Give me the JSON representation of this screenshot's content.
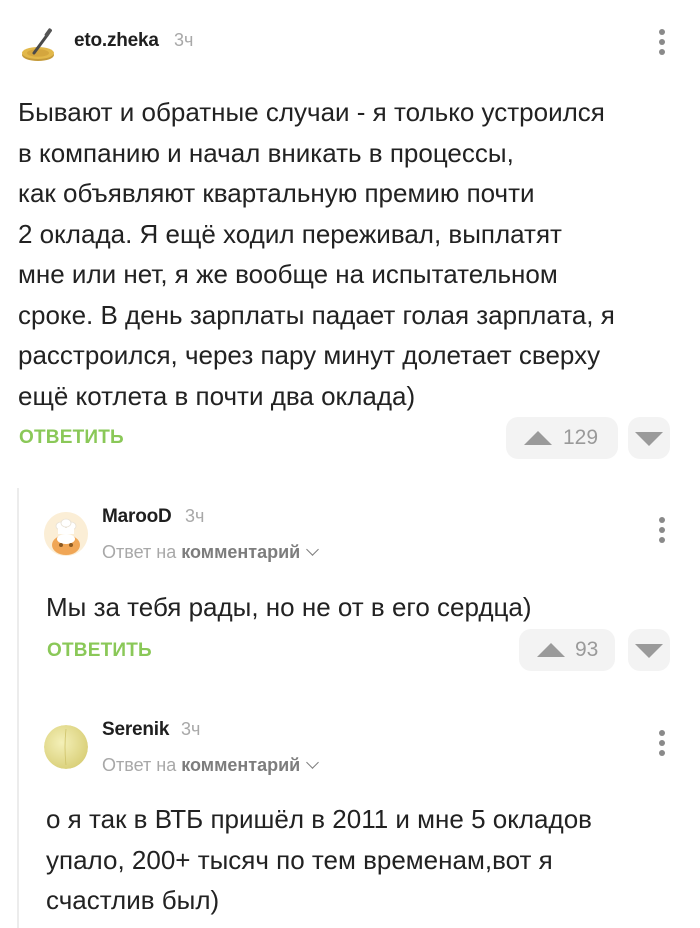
{
  "comments": [
    {
      "author": "eto.zheka",
      "time": "3ч",
      "text": "Бывают и обратные случаи - я только устроился\nв компанию и начал вникать в процессы,\nкак объявляют квартальную премию почти\n2 оклада. Я ещё ходил переживал, выплатят\nмне или нет, я же вообще на испытательном\nсроке. В день зарплаты падает голая зарплата, я\nрасстроился, через пару минут долетает сверху\nещё котлета в почти два оклада)",
      "reply_label": "ОТВЕТИТЬ",
      "rating": "129"
    },
    {
      "author": "MarooD",
      "time": "3ч",
      "reply_to_prefix": "Ответ на",
      "reply_to_target": "комментарий",
      "text": "Мы за тебя рады, но не от в его сердца)",
      "reply_label": "ОТВЕТИТЬ",
      "rating": "93"
    },
    {
      "author": "Serenik",
      "time": "3ч",
      "reply_to_prefix": "Ответ на",
      "reply_to_target": "комментарий",
      "text": "о я так в ВТБ пришёл в 2011 и мне 5 окладов\nупало, 200+ тысяч по тем временам,вот я\nсчастлив был)"
    }
  ],
  "colors": {
    "accent_green": "#8ac858",
    "muted_text": "#a8a8a8",
    "vote_bg": "#f3f3f3"
  },
  "icons": {
    "menu": "more-vertical-icon",
    "vote_up": "triangle-up-icon",
    "vote_down": "triangle-down-icon",
    "reply_chevron": "chevron-down-icon"
  }
}
